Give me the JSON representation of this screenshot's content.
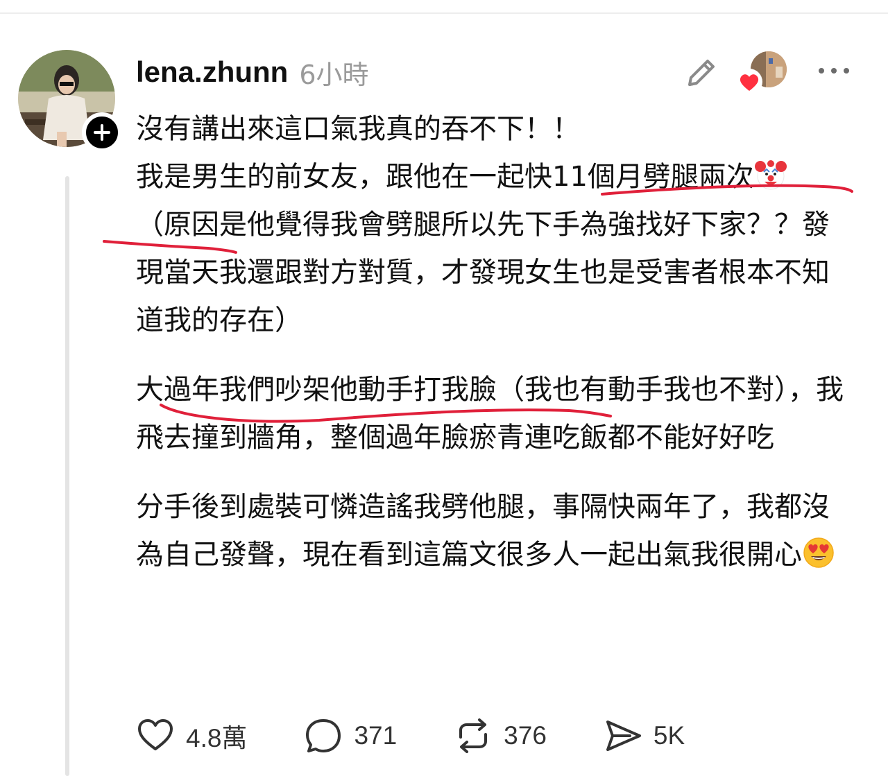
{
  "post": {
    "username": "lena.zhunn",
    "time": "6小時",
    "paragraphs": [
      {
        "lines": [
          "沒有講出來這口氣我真的吞不下！！",
          "我是男生的前女友，跟他在一起快11個月劈腿兩次",
          "（原因是他覺得我會劈腿所以先下手為強找好下家？？發現當天我還跟對方對質，才發現女生也是受害者根本不知道我的存在）"
        ]
      },
      {
        "text": "大過年我們吵架他動手打我臉（我也有動手我也不對），我飛去撞到牆角，整個過年臉瘀青連吃飯都不能好好吃"
      },
      {
        "text": "分手後到處裝可憐造謠我劈他腿，事隔快兩年了，我都沒為自己發聲，現在看到這篇文很多人一起出氣我很開心"
      }
    ],
    "emoji": [
      "clown-face",
      "smiling-face-with-heart-eyes"
    ]
  },
  "actions": {
    "likes": "4.8萬",
    "replies": "371",
    "reposts": "376",
    "shares": "5K"
  },
  "colors": {
    "annotation_red": "#e0203a",
    "reaction_heart": "#ff3040",
    "muted_text": "#9a9a9a",
    "thread_line": "#e4e4e4"
  }
}
